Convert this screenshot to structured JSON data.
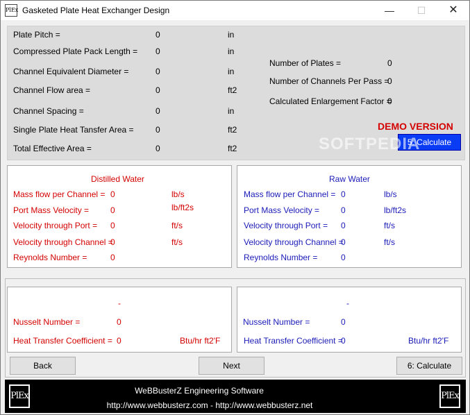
{
  "window": {
    "title": "Gasketed Plate Heat Exchanger Design",
    "icon_text": "PlEx",
    "minimize": "—",
    "maximize": "☐",
    "close": "✕"
  },
  "top": {
    "left_rows": [
      {
        "label": "Plate Pitch =",
        "value": "0",
        "unit": "in"
      },
      {
        "label": "Compressed Plate Pack Length =",
        "value": "0",
        "unit": "in"
      },
      {
        "label": "Channel Equivalent Diameter =",
        "value": "0",
        "unit": "in"
      },
      {
        "label": "Channel Flow area =",
        "value": "0",
        "unit": "ft2"
      },
      {
        "label": "Channel Spacing =",
        "value": "0",
        "unit": "in"
      },
      {
        "label": "Single Plate Heat Tansfer Area =",
        "value": "0",
        "unit": "ft2"
      },
      {
        "label": "Total Effective Area =",
        "value": "0",
        "unit": "ft2"
      }
    ],
    "right_rows": [
      {
        "label": "Number of Plates =",
        "value": "0"
      },
      {
        "label": "Number of Channels Per Pass =",
        "value": "0"
      },
      {
        "label": "Calculated Enlargement Factor =",
        "value": "0"
      }
    ],
    "demo_label": "DEMO VERSION",
    "calc5_label": "5: Calculate"
  },
  "distilled": {
    "title": "Distilled Water",
    "rows": [
      {
        "label": "Mass flow per Channel =",
        "value": "0",
        "unit": "lb/s"
      },
      {
        "label": "Port Mass Velocity =",
        "value": "0",
        "unit": "lb/ft2s"
      },
      {
        "label": "Velocity through Port =",
        "value": "0",
        "unit": "ft/s"
      },
      {
        "label": "Velocity through Channel =",
        "value": "0",
        "unit": "ft/s"
      },
      {
        "label": "Reynolds Number =",
        "value": "0",
        "unit": ""
      }
    ],
    "lower_title": "-",
    "nusselt_label": "Nusselt Number =",
    "nusselt_value": "0",
    "htc_label": "Heat Transfer Coefficient =",
    "htc_value": "0",
    "htc_unit": "Btu/hr ft2'F"
  },
  "raw": {
    "title": "Raw Water",
    "rows": [
      {
        "label": "Mass flow per Channel =",
        "value": "0",
        "unit": "lb/s"
      },
      {
        "label": "Port Mass Velocity =",
        "value": "0",
        "unit": "lb/ft2s"
      },
      {
        "label": "Velocity through Port =",
        "value": "0",
        "unit": "ft/s"
      },
      {
        "label": "Velocity through Channel =",
        "value": "0",
        "unit": "ft/s"
      },
      {
        "label": "Reynolds Number =",
        "value": "0",
        "unit": ""
      }
    ],
    "lower_title": "-",
    "nusselt_label": "Nusselt Number =",
    "nusselt_value": "0",
    "htc_label": "Heat Transfer Coefficient =",
    "htc_value": "0",
    "htc_unit": "Btu/hr ft2'F"
  },
  "buttons": {
    "back": "Back",
    "next": "Next",
    "calc6": "6: Calculate"
  },
  "footer": {
    "company": "WeBBusterZ Engineering Software",
    "links": "http://www.webbusterz.com - http://www.webbusterz.net",
    "logo_text": "PlEx"
  },
  "watermark": "SOFTPEDIA",
  "colors": {
    "distilled": "#d40000",
    "raw": "#1a1ab8",
    "calc5_bg": "#0a3cf5"
  }
}
